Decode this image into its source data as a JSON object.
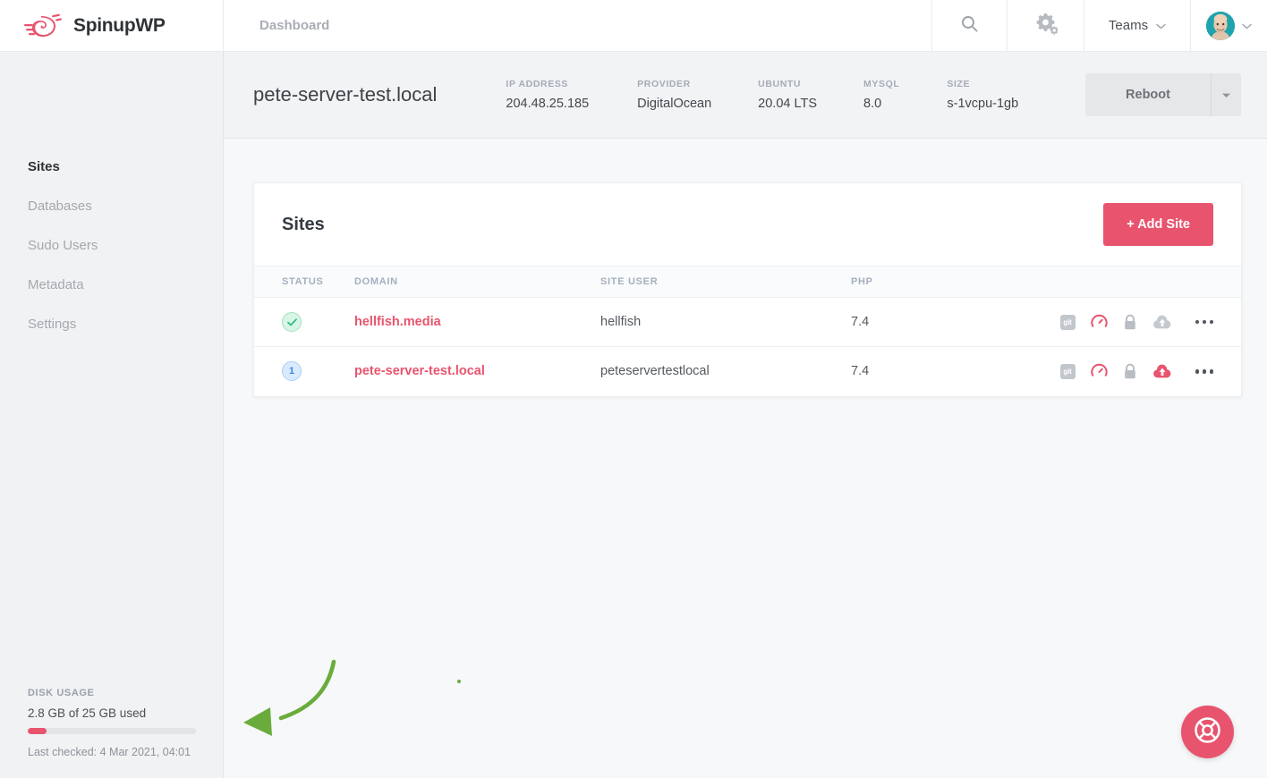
{
  "brand": {
    "name": "SpinupWP",
    "logo_icon": "spinupwp-logo-icon"
  },
  "topbar": {
    "nav_title": "Dashboard",
    "search_icon": "search-icon",
    "settings_icon": "gear-icon",
    "teams_label": "Teams",
    "teams_caret_icon": "chevron-down-icon",
    "user_caret_icon": "chevron-down-icon",
    "avatar_alt": "user-avatar"
  },
  "server": {
    "name": "pete-server-test.local",
    "meta": [
      {
        "label": "IP ADDRESS",
        "value": "204.48.25.185"
      },
      {
        "label": "PROVIDER",
        "value": "DigitalOcean"
      },
      {
        "label": "UBUNTU",
        "value": "20.04 LTS"
      },
      {
        "label": "MYSQL",
        "value": "8.0"
      },
      {
        "label": "SIZE",
        "value": "s-1vcpu-1gb"
      }
    ],
    "reboot_label": "Reboot",
    "reboot_caret_icon": "caret-down-icon"
  },
  "sidebar": {
    "items": [
      {
        "label": "Sites",
        "active": true
      },
      {
        "label": "Databases",
        "active": false
      },
      {
        "label": "Sudo Users",
        "active": false
      },
      {
        "label": "Metadata",
        "active": false
      },
      {
        "label": "Settings",
        "active": false
      }
    ],
    "disk": {
      "heading": "DISK USAGE",
      "used_text": "2.8 GB of 25 GB used",
      "percent": 11.2,
      "last_checked": "Last checked: 4 Mar 2021, 04:01",
      "fill_color": "#e8546e"
    }
  },
  "sites_card": {
    "title": "Sites",
    "add_button_label": "+ Add Site",
    "add_button_color": "#e8546e",
    "columns": [
      "STATUS",
      "DOMAIN",
      "SITE USER",
      "PHP",
      ""
    ],
    "rows": [
      {
        "status_type": "ok",
        "status_text": "✓",
        "domain": "hellfish.media",
        "site_user": "hellfish",
        "php": "7.4",
        "actions": [
          {
            "icon": "git-icon",
            "label": "git",
            "active": false
          },
          {
            "icon": "speedometer-icon",
            "label": "",
            "active": true
          },
          {
            "icon": "lock-icon",
            "label": "",
            "active": false
          },
          {
            "icon": "cloud-upload-icon",
            "label": "",
            "active": false
          },
          {
            "icon": "more-options-icon",
            "label": "",
            "active": false
          }
        ]
      },
      {
        "status_type": "count",
        "status_text": "1",
        "domain": "pete-server-test.local",
        "site_user": "peteservertestlocal",
        "php": "7.4",
        "actions": [
          {
            "icon": "git-icon",
            "label": "git",
            "active": false
          },
          {
            "icon": "speedometer-icon",
            "label": "",
            "active": true
          },
          {
            "icon": "lock-icon",
            "label": "",
            "active": false
          },
          {
            "icon": "cloud-upload-icon",
            "label": "",
            "active": true
          },
          {
            "icon": "more-options-icon",
            "label": "",
            "active": false
          }
        ]
      }
    ]
  },
  "support": {
    "icon": "life-ring-icon",
    "color": "#e8546e"
  },
  "annotation": {
    "icon": "green-curved-arrow",
    "color": "#6aac3c"
  }
}
